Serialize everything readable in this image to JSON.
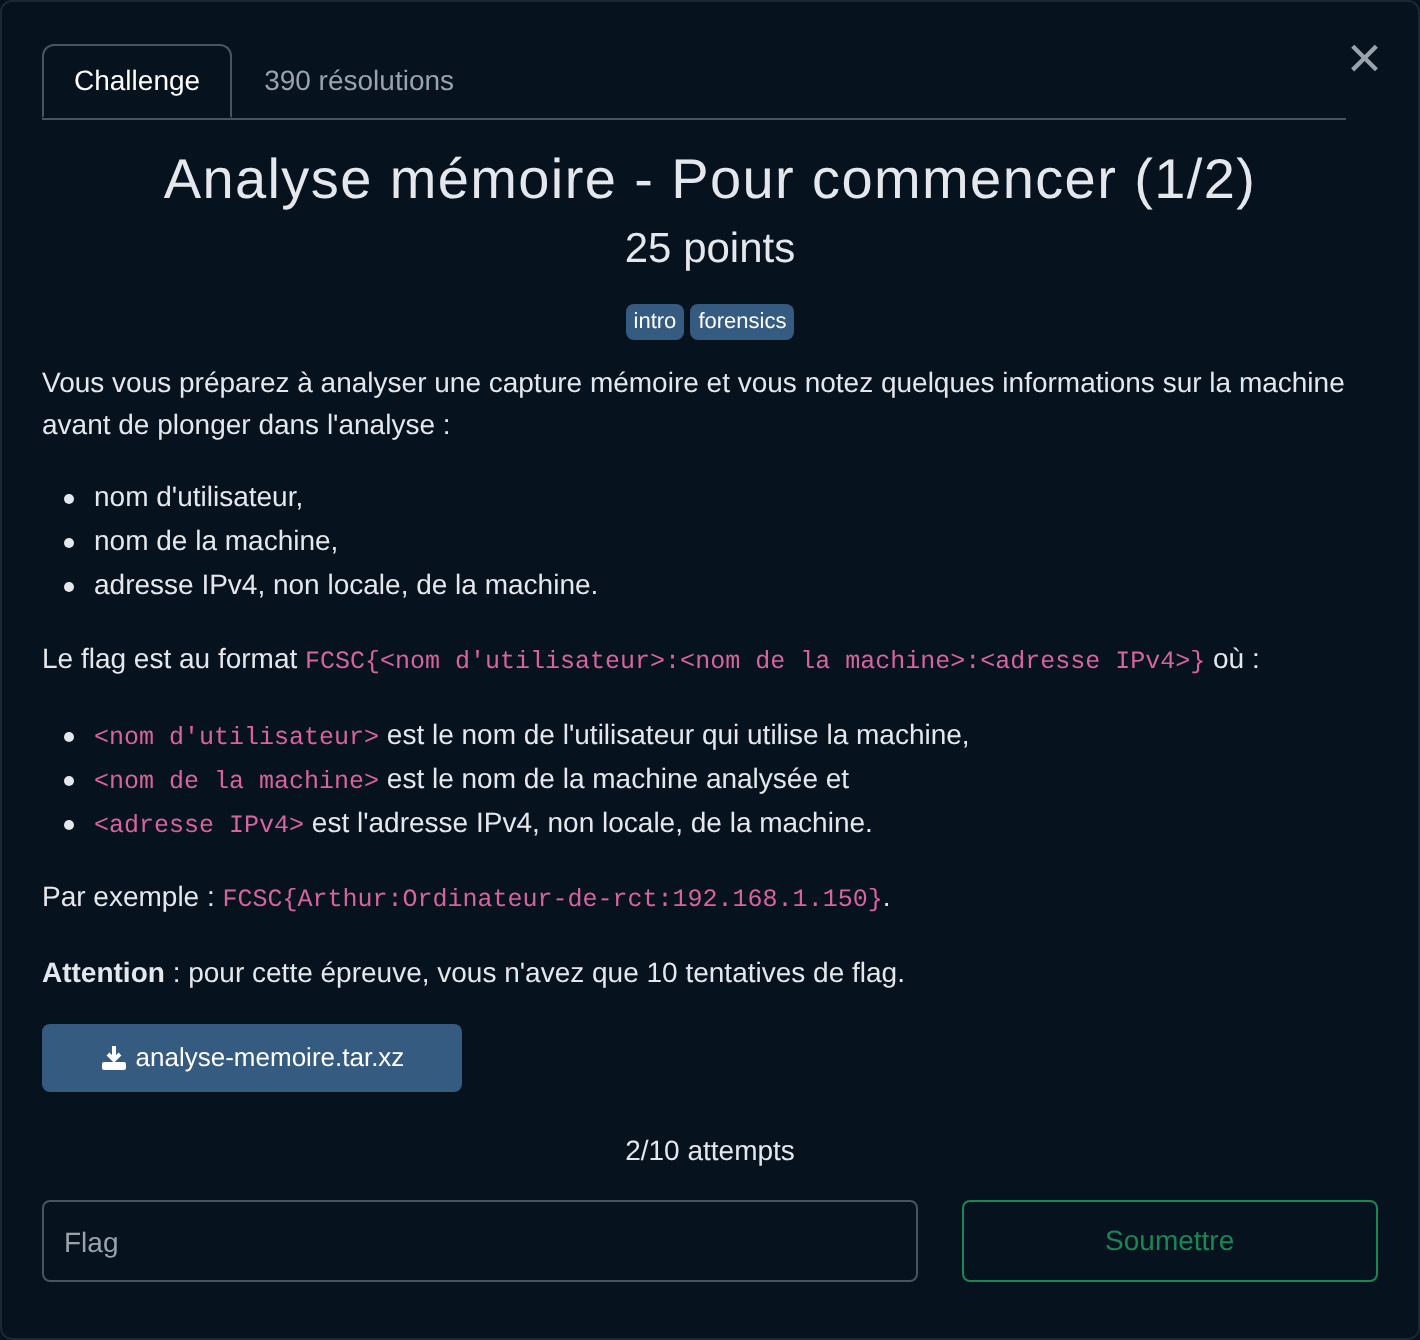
{
  "tabs": [
    {
      "label": "Challenge",
      "selected": true
    },
    {
      "label": "390 résolutions",
      "selected": false
    }
  ],
  "close": "×",
  "title": "Analyse mémoire - Pour commencer (1/2)",
  "points": "25 points",
  "tags": [
    "intro",
    "forensics"
  ],
  "blocks": [
    {
      "kind": "paragraph",
      "parts": [
        {
          "kind": "text",
          "text": "Vous vous préparez à analyser une capture mémoire et vous notez quelques informations sur la machine avant de plonger dans l'analyse :"
        }
      ]
    },
    {
      "kind": "list",
      "items": [
        {
          "parts": [
            {
              "kind": "text",
              "text": "nom d'utilisateur,"
            }
          ]
        },
        {
          "parts": [
            {
              "kind": "text",
              "text": "nom de la machine,"
            }
          ]
        },
        {
          "parts": [
            {
              "kind": "text",
              "text": "adresse IPv4, non locale, de la machine."
            }
          ]
        }
      ]
    },
    {
      "kind": "paragraph",
      "parts": [
        {
          "kind": "text",
          "text": "Le flag est au format "
        },
        {
          "kind": "code",
          "text": "FCSC{<nom d'utilisateur>:<nom de la machine>:<adresse IPv4>}"
        },
        {
          "kind": "text",
          "text": " où :"
        }
      ]
    },
    {
      "kind": "list",
      "items": [
        {
          "parts": [
            {
              "kind": "code",
              "text": "<nom d'utilisateur>"
            },
            {
              "kind": "text",
              "text": " est le nom de l'utilisateur qui utilise la machine,"
            }
          ]
        },
        {
          "parts": [
            {
              "kind": "code",
              "text": "<nom de la machine>"
            },
            {
              "kind": "text",
              "text": " est le nom de la machine analysée et"
            }
          ]
        },
        {
          "parts": [
            {
              "kind": "code",
              "text": "<adresse IPv4>"
            },
            {
              "kind": "text",
              "text": " est l'adresse IPv4, non locale, de la machine."
            }
          ]
        }
      ]
    },
    {
      "kind": "paragraph",
      "parts": [
        {
          "kind": "text",
          "text": "Par exemple : "
        },
        {
          "kind": "code",
          "text": "FCSC{Arthur:Ordinateur-de-rct:192.168.1.150}"
        },
        {
          "kind": "text",
          "text": "."
        }
      ]
    },
    {
      "kind": "paragraph",
      "parts": [
        {
          "kind": "text",
          "text": "**Attention** : pour cette épreuve, vous n'avez que 10 tentatives de flag."
        }
      ]
    }
  ],
  "download": "analyse-memoire.tar.xz",
  "attempts": "2/10 attempts",
  "flag_field": {
    "placeholder": "Flag"
  },
  "submit": "Soumettre"
}
